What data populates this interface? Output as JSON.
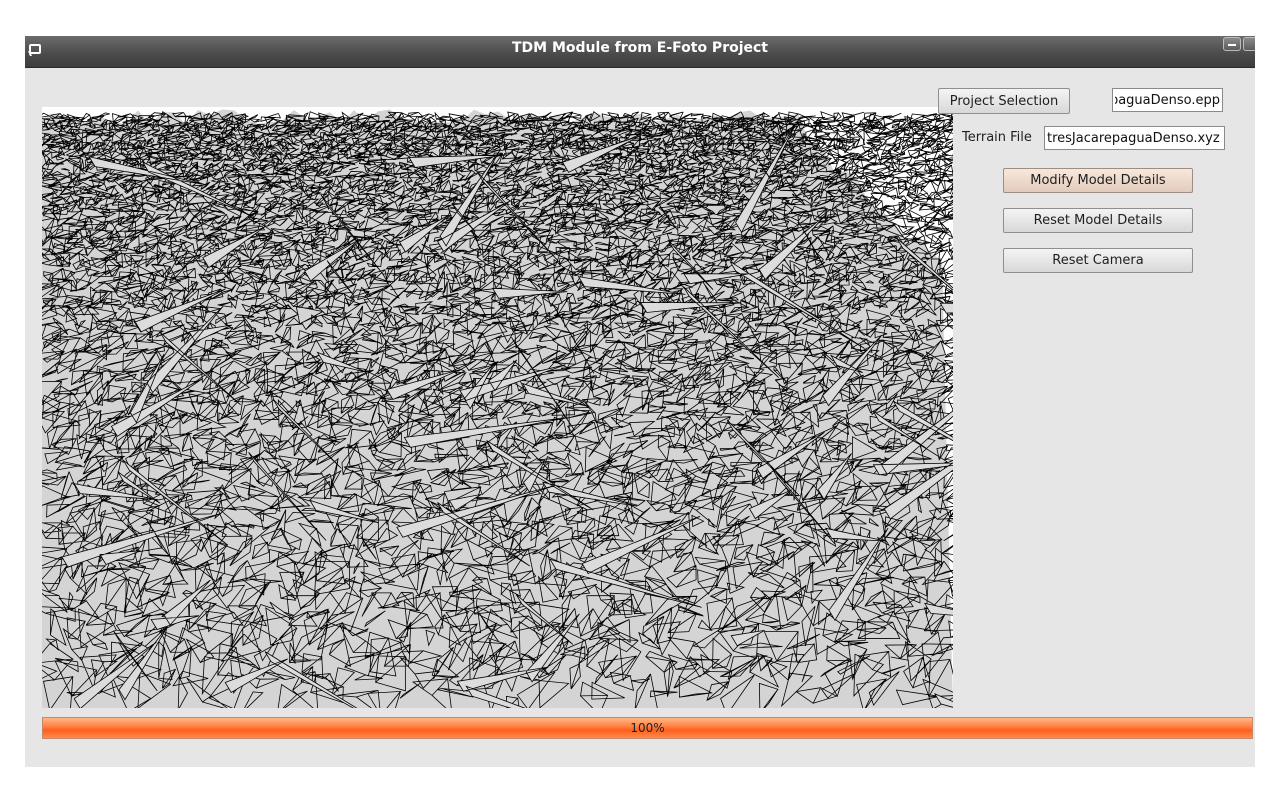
{
  "window": {
    "title": "TDM Module from E-Foto Project"
  },
  "controls": {
    "project_selection_label": "Project Selection",
    "project_file_value": "paguaDenso.epp",
    "terrain_file_label": "Terrain File",
    "terrain_file_value": "tresJacarepaguaDenso.xyz",
    "modify_model_label": "Modify Model Details",
    "reset_model_label": "Reset Model Details",
    "reset_camera_label": "Reset Camera"
  },
  "progress": {
    "value": 1.0,
    "text": "100%"
  },
  "colors": {
    "mesh_fill": "#d4d4d4",
    "mesh_line": "#000000",
    "progress_accent": "#ff6a2a",
    "hover_button": "#e9d6c9"
  },
  "icons": {
    "window_icon": "window-icon",
    "minimize": "minimize-icon"
  }
}
